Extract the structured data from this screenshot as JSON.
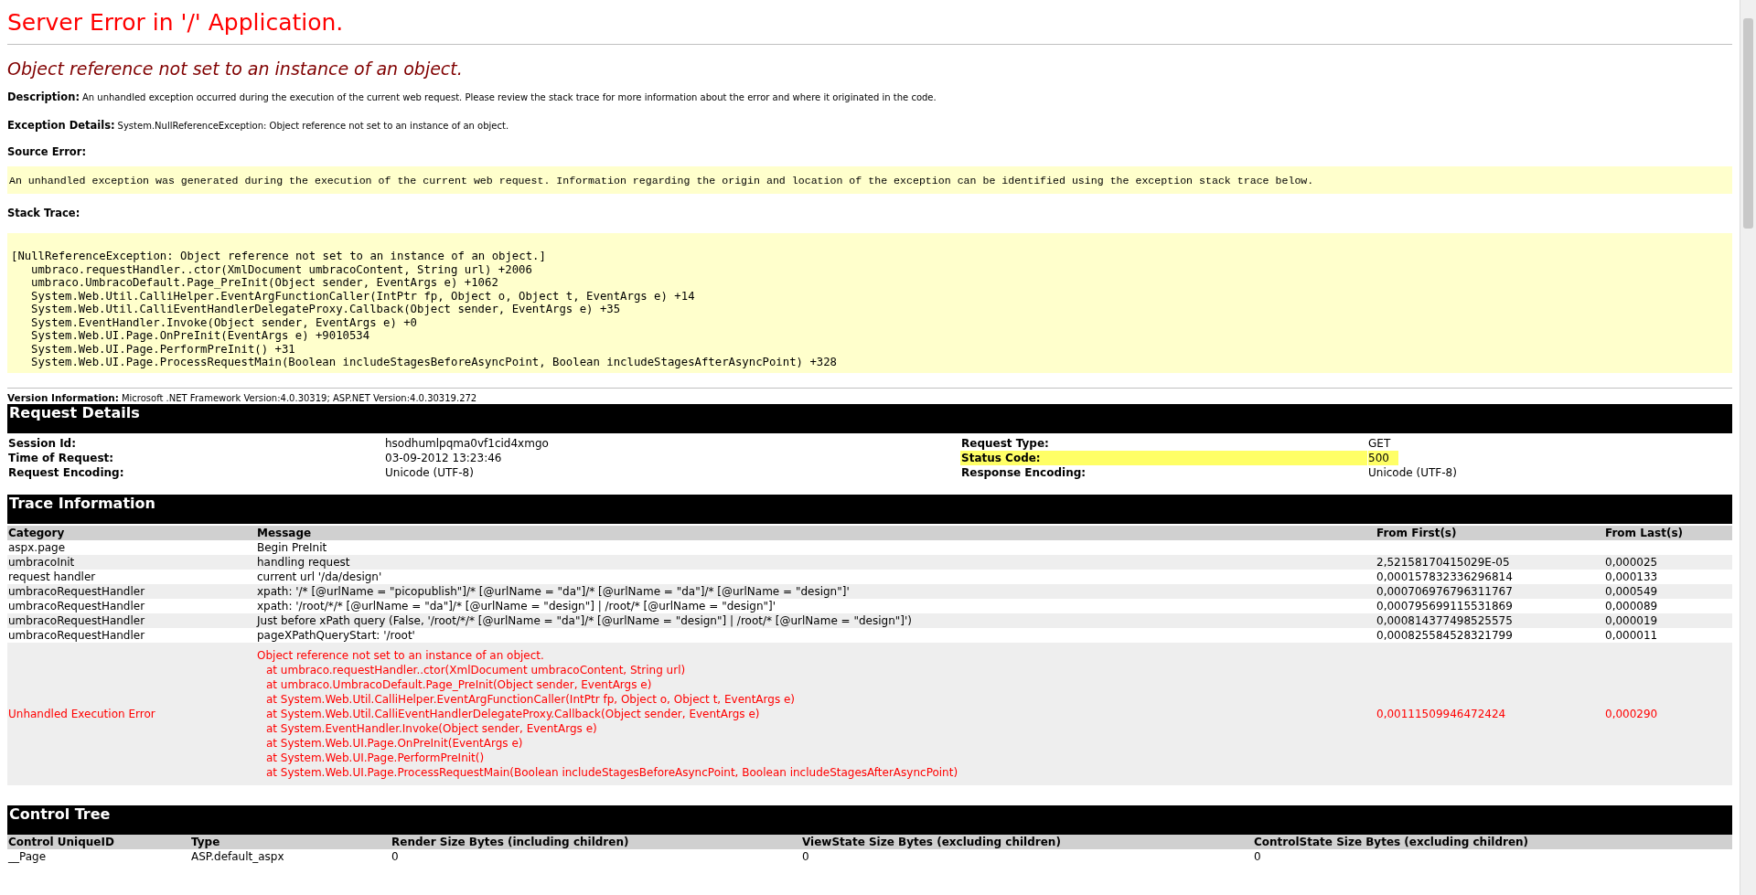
{
  "title": "Server Error in '/' Application.",
  "error_message": "Object reference not set to an instance of an object.",
  "description": {
    "label": "Description:",
    "text": "An unhandled exception occurred during the execution of the current web request. Please review the stack trace for more information about the error and where it originated in the code."
  },
  "exception_details": {
    "label": "Exception Details:",
    "text": "System.NullReferenceException: Object reference not set to an instance of an object."
  },
  "source_error": {
    "label": "Source Error:",
    "text": "An unhandled exception was generated during the execution of the current web request. Information regarding the origin and location of the exception can be identified using the exception stack trace below."
  },
  "stack_trace": {
    "label": "Stack Trace:",
    "exception": "[NullReferenceException: Object reference not set to an instance of an object.]",
    "frames": [
      "umbraco.requestHandler..ctor(XmlDocument umbracoContent, String url) +2006",
      "umbraco.UmbracoDefault.Page_PreInit(Object sender, EventArgs e) +1062",
      "System.Web.Util.CalliHelper.EventArgFunctionCaller(IntPtr fp, Object o, Object t, EventArgs e) +14",
      "System.Web.Util.CalliEventHandlerDelegateProxy.Callback(Object sender, EventArgs e) +35",
      "System.EventHandler.Invoke(Object sender, EventArgs e) +0",
      "System.Web.UI.Page.OnPreInit(EventArgs e) +9010534",
      "System.Web.UI.Page.PerformPreInit() +31",
      "System.Web.UI.Page.ProcessRequestMain(Boolean includeStagesBeforeAsyncPoint, Boolean includeStagesAfterAsyncPoint) +328"
    ]
  },
  "version_info": {
    "label": "Version Information:",
    "text": "Microsoft .NET Framework Version:4.0.30319; ASP.NET Version:4.0.30319.272"
  },
  "request_details": {
    "title": "Request Details",
    "rows": [
      {
        "label": "Session Id:",
        "value": "hsodhumlpqma0vf1cid4xmgo",
        "label_2": "Request Type:",
        "value_2": "GET",
        "highlighted": false
      },
      {
        "label": "Time of Request:",
        "value": "03-09-2012 13:23:46",
        "label_2": "Status Code:",
        "value_2": "500",
        "highlighted": true
      },
      {
        "label": "Request Encoding:",
        "value": "Unicode (UTF-8)",
        "label_2": "Response Encoding:",
        "value_2": "Unicode (UTF-8)",
        "highlighted": false
      }
    ]
  },
  "trace_information": {
    "title": "Trace Information",
    "columns": [
      "Category",
      "Message",
      "From First(s)",
      "From Last(s)"
    ],
    "rows": [
      {
        "kind": "normal",
        "category": "aspx.page",
        "message": "Begin PreInit"
      },
      {
        "kind": "normal",
        "category": "umbracoInit",
        "message": "handling request",
        "from_first": "2,52158170415029E-05",
        "from_last": "0,000025"
      },
      {
        "kind": "normal",
        "category": "request handler",
        "message": "current url '/da/design'",
        "from_first": "0,000157832336296814",
        "from_last": "0,000133"
      },
      {
        "kind": "normal",
        "category": "umbracoRequestHandler",
        "message": "xpath: '/* [@urlName = \"picopublish\"]/* [@urlName = \"da\"]/* [@urlName = \"da\"]/* [@urlName = \"design\"]'",
        "from_first": "0,000706976796311767",
        "from_last": "0,000549"
      },
      {
        "kind": "normal",
        "category": "umbracoRequestHandler",
        "message": "xpath: '/root/*/* [@urlName = \"da\"]/* [@urlName = \"design\"] | /root/* [@urlName = \"design\"]'",
        "from_first": "0,000795699115531869",
        "from_last": "0,000089"
      },
      {
        "kind": "normal",
        "category": "umbracoRequestHandler",
        "message": "Just before xPath query (False, '/root/*/* [@urlName = \"da\"]/* [@urlName = \"design\"] | /root/* [@urlName = \"design\"]')",
        "from_first": "0,000814377498525575",
        "from_last": "0,000019"
      },
      {
        "kind": "normal",
        "category": "umbracoRequestHandler",
        "message": "pageXPathQueryStart: '/root'",
        "from_first": "0,000825584528321799",
        "from_last": "0,000011"
      },
      {
        "kind": "error",
        "category": "Unhandled Execution Error",
        "message": "Object reference not set to an instance of an object.",
        "frames": [
          "at umbraco.requestHandler..ctor(XmlDocument umbracoContent, String url)",
          "at umbraco.UmbracoDefault.Page_PreInit(Object sender, EventArgs e)",
          "at System.Web.Util.CalliHelper.EventArgFunctionCaller(IntPtr fp, Object o, Object t, EventArgs e)",
          "at System.Web.Util.CalliEventHandlerDelegateProxy.Callback(Object sender, EventArgs e)",
          "at System.EventHandler.Invoke(Object sender, EventArgs e)",
          "at System.Web.UI.Page.OnPreInit(EventArgs e)",
          "at System.Web.UI.Page.PerformPreInit()",
          "at System.Web.UI.Page.ProcessRequestMain(Boolean includeStagesBeforeAsyncPoint, Boolean includeStagesAfterAsyncPoint)"
        ],
        "from_first": "0,00111509946472424",
        "from_last": "0,000290"
      }
    ]
  },
  "control_tree": {
    "title": "Control Tree",
    "columns": [
      "Control UniqueID",
      "Type",
      "Render Size Bytes (including children)",
      "ViewState Size Bytes (excluding children)",
      "ControlState Size Bytes (excluding children)"
    ],
    "rows": [
      [
        "__Page",
        "ASP.default_aspx",
        "0",
        "0",
        "0"
      ]
    ]
  }
}
